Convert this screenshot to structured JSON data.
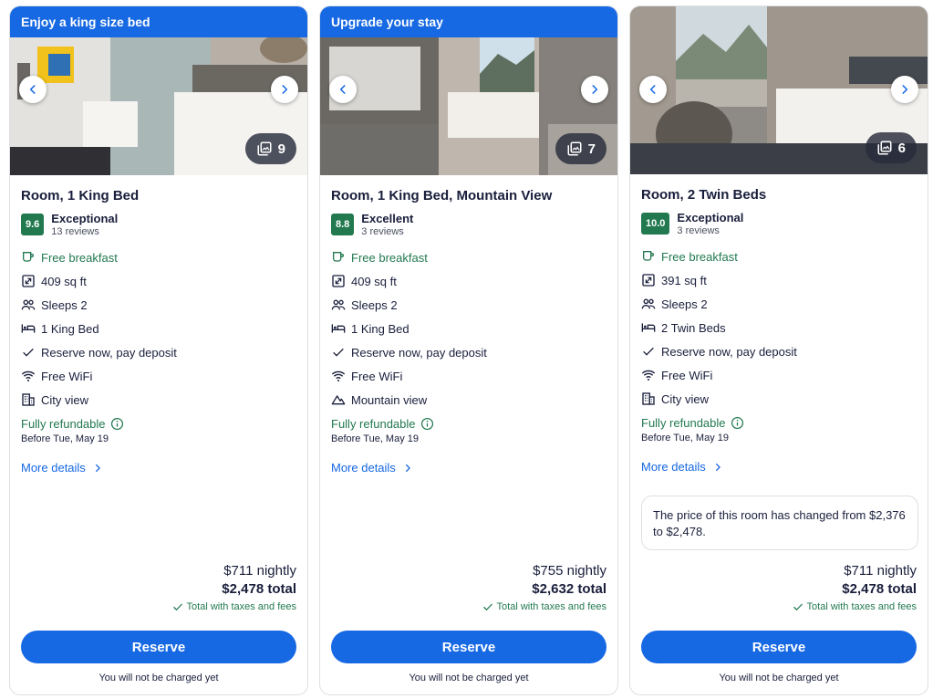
{
  "cards": [
    {
      "banner": "Enjoy a king size bed",
      "photo_count": "9",
      "title": "Room, 1 King Bed",
      "score": "9.6",
      "score_label": "Exceptional",
      "reviews": "13 reviews",
      "features": {
        "breakfast": "Free breakfast",
        "size": "409 sq ft",
        "sleeps": "Sleeps 2",
        "bed": "1 King Bed",
        "reserve": "Reserve now, pay deposit",
        "wifi": "Free WiFi",
        "view": "City view"
      },
      "refund": "Fully refundable",
      "before": "Before Tue, May 19",
      "more": "More details",
      "nightly": "$711 nightly",
      "total": "$2,478 total",
      "taxes": "Total with taxes and fees",
      "reserve_btn": "Reserve",
      "no_charge": "You will not be charged yet"
    },
    {
      "banner": "Upgrade your stay",
      "photo_count": "7",
      "title": "Room, 1 King Bed, Mountain View",
      "score": "8.8",
      "score_label": "Excellent",
      "reviews": "3 reviews",
      "features": {
        "breakfast": "Free breakfast",
        "size": "409 sq ft",
        "sleeps": "Sleeps 2",
        "bed": "1 King Bed",
        "reserve": "Reserve now, pay deposit",
        "wifi": "Free WiFi",
        "view": "Mountain view"
      },
      "refund": "Fully refundable",
      "before": "Before Tue, May 19",
      "more": "More details",
      "nightly": "$755 nightly",
      "total": "$2,632 total",
      "taxes": "Total with taxes and fees",
      "reserve_btn": "Reserve",
      "no_charge": "You will not be charged yet"
    },
    {
      "photo_count": "6",
      "title": "Room, 2 Twin Beds",
      "score": "10.0",
      "score_label": "Exceptional",
      "reviews": "3 reviews",
      "features": {
        "breakfast": "Free breakfast",
        "size": "391 sq ft",
        "sleeps": "Sleeps 2",
        "bed": "2 Twin Beds",
        "reserve": "Reserve now, pay deposit",
        "wifi": "Free WiFi",
        "view": "City view"
      },
      "refund": "Fully refundable",
      "before": "Before Tue, May 19",
      "more": "More details",
      "price_notice": "The price of this room has changed from $2,376 to $2,478.",
      "nightly": "$711 nightly",
      "total": "$2,478 total",
      "taxes": "Total with taxes and fees",
      "reserve_btn": "Reserve",
      "no_charge": "You will not be charged yet"
    }
  ],
  "colors": {
    "brand_blue": "#1668e3",
    "score_green": "#227950",
    "text": "#191e3b"
  }
}
